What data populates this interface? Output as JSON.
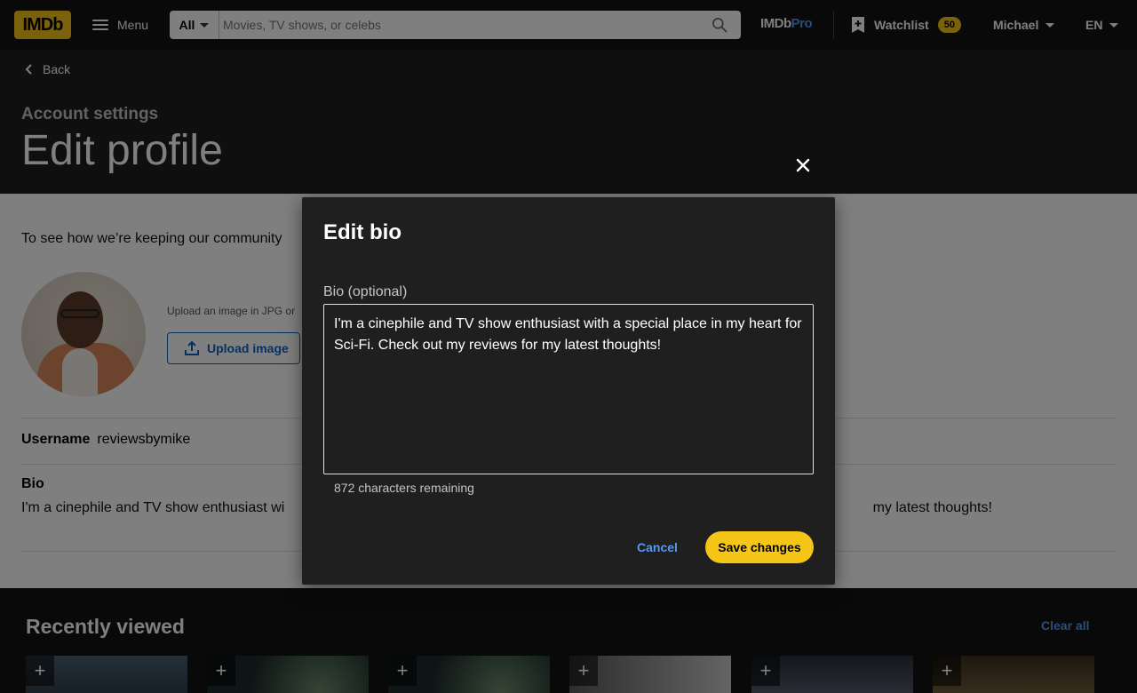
{
  "nav": {
    "logo": "IMDb",
    "menu_label": "Menu",
    "search_category": "All",
    "search_placeholder": "Movies, TV shows, or celebs",
    "imdbpro_prefix": "IMDb",
    "imdbpro_suffix": "Pro",
    "watchlist_label": "Watchlist",
    "watchlist_count": "50",
    "user_name": "Michael",
    "language": "EN"
  },
  "header": {
    "back_label": "Back",
    "breadcrumb": "Account settings",
    "title": "Edit profile"
  },
  "profile": {
    "guideline_text": "To see how we’re keeping our community",
    "upload_hint": "Upload an image in JPG or",
    "upload_button": "Upload image",
    "username_label": "Username",
    "username_value": "reviewsbymike",
    "bio_label": "Bio",
    "bio_value": "I'm a cinephile and TV show enthusiast wi                                                                                                                                                     my latest thoughts!"
  },
  "recent": {
    "title": "Recently viewed",
    "clear_label": "Clear all",
    "add_symbol": "+"
  },
  "dialog": {
    "title": "Edit bio",
    "field_label": "Bio (optional)",
    "bio_value": "I'm a cinephile and TV show enthusiast with a special place in my heart for Sci-Fi. Check out my reviews for my latest thoughts!",
    "chars_remaining": "872 characters remaining",
    "cancel_label": "Cancel",
    "save_label": "Save changes"
  },
  "colors": {
    "brand_yellow": "#f5c518",
    "link_blue": "#5799ef",
    "dark_bg": "#1f1f1f"
  }
}
